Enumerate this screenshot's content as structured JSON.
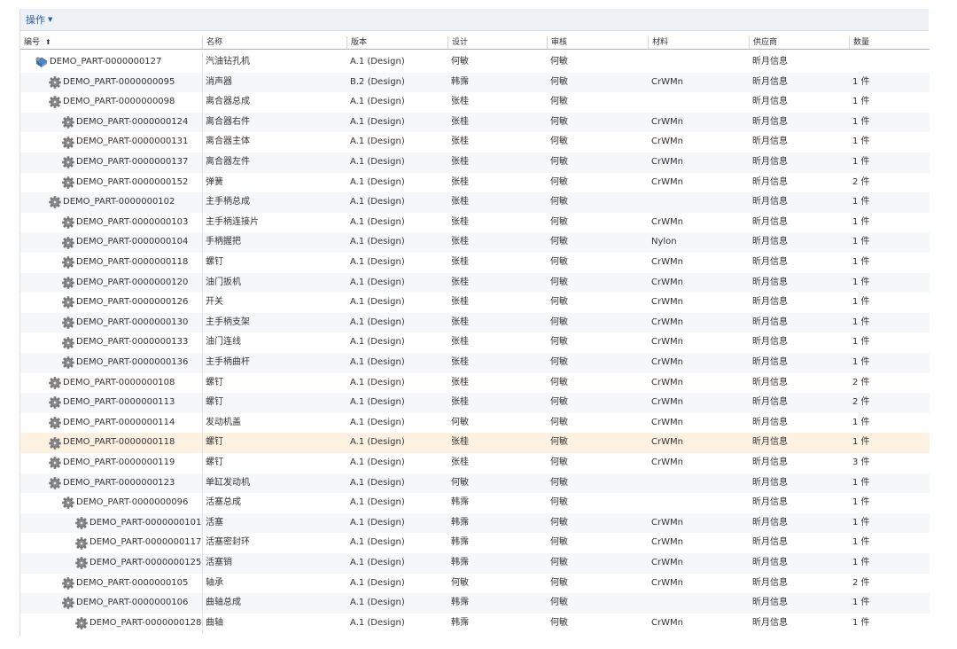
{
  "toolbar": {
    "action_label": "操作",
    "caret_icon": "caret-down-icon"
  },
  "columns": [
    {
      "key": "number",
      "label": "编号",
      "sort_icon": "sort-up-icon"
    },
    {
      "key": "name",
      "label": "名称"
    },
    {
      "key": "version",
      "label": "版本"
    },
    {
      "key": "design",
      "label": "设计"
    },
    {
      "key": "review",
      "label": "审核"
    },
    {
      "key": "material",
      "label": "材料"
    },
    {
      "key": "supplier",
      "label": "供应商"
    },
    {
      "key": "quantity",
      "label": "数量"
    }
  ],
  "icons": {
    "root": "assembly-icon",
    "part": "gear-part-icon"
  },
  "rows": [
    {
      "level": 0,
      "number": "DEMO_PART-0000000127",
      "name": "汽油钻孔机",
      "version": "A.1 (Design)",
      "design": "何敏",
      "review": "何敏",
      "material": "",
      "supplier": "昕月信息",
      "quantity": ""
    },
    {
      "level": 1,
      "number": "DEMO_PART-0000000095",
      "name": "消声器",
      "version": "B.2 (Design)",
      "design": "韩霈",
      "review": "何敏",
      "material": "CrWMn",
      "supplier": "昕月信息",
      "quantity": "1 件"
    },
    {
      "level": 1,
      "number": "DEMO_PART-0000000098",
      "name": "离合器总成",
      "version": "A.1 (Design)",
      "design": "张桂",
      "review": "何敏",
      "material": "",
      "supplier": "昕月信息",
      "quantity": "1 件"
    },
    {
      "level": 2,
      "number": "DEMO_PART-0000000124",
      "name": "离合器右件",
      "version": "A.1 (Design)",
      "design": "张桂",
      "review": "何敏",
      "material": "CrWMn",
      "supplier": "昕月信息",
      "quantity": "1 件"
    },
    {
      "level": 2,
      "number": "DEMO_PART-0000000131",
      "name": "离合器主体",
      "version": "A.1 (Design)",
      "design": "张桂",
      "review": "何敏",
      "material": "CrWMn",
      "supplier": "昕月信息",
      "quantity": "1 件"
    },
    {
      "level": 2,
      "number": "DEMO_PART-0000000137",
      "name": "离合器左件",
      "version": "A.1 (Design)",
      "design": "张桂",
      "review": "何敏",
      "material": "CrWMn",
      "supplier": "昕月信息",
      "quantity": "1 件"
    },
    {
      "level": 2,
      "number": "DEMO_PART-0000000152",
      "name": "弹簧",
      "version": "A.1 (Design)",
      "design": "张桂",
      "review": "何敏",
      "material": "CrWMn",
      "supplier": "昕月信息",
      "quantity": "2 件"
    },
    {
      "level": 1,
      "number": "DEMO_PART-0000000102",
      "name": "主手柄总成",
      "version": "A.1 (Design)",
      "design": "张桂",
      "review": "何敏",
      "material": "",
      "supplier": "昕月信息",
      "quantity": "1 件"
    },
    {
      "level": 2,
      "number": "DEMO_PART-0000000103",
      "name": "主手柄连接片",
      "version": "A.1 (Design)",
      "design": "张桂",
      "review": "何敏",
      "material": "CrWMn",
      "supplier": "昕月信息",
      "quantity": "1 件"
    },
    {
      "level": 2,
      "number": "DEMO_PART-0000000104",
      "name": "手柄握把",
      "version": "A.1 (Design)",
      "design": "张桂",
      "review": "何敏",
      "material": "Nylon",
      "supplier": "昕月信息",
      "quantity": "1 件"
    },
    {
      "level": 2,
      "number": "DEMO_PART-0000000118",
      "name": "螺钉",
      "version": "A.1 (Design)",
      "design": "张桂",
      "review": "何敏",
      "material": "CrWMn",
      "supplier": "昕月信息",
      "quantity": "1 件"
    },
    {
      "level": 2,
      "number": "DEMO_PART-0000000120",
      "name": "油门扳机",
      "version": "A.1 (Design)",
      "design": "张桂",
      "review": "何敏",
      "material": "CrWMn",
      "supplier": "昕月信息",
      "quantity": "1 件"
    },
    {
      "level": 2,
      "number": "DEMO_PART-0000000126",
      "name": "开关",
      "version": "A.1 (Design)",
      "design": "张桂",
      "review": "何敏",
      "material": "CrWMn",
      "supplier": "昕月信息",
      "quantity": "1 件"
    },
    {
      "level": 2,
      "number": "DEMO_PART-0000000130",
      "name": "主手柄支架",
      "version": "A.1 (Design)",
      "design": "张桂",
      "review": "何敏",
      "material": "CrWMn",
      "supplier": "昕月信息",
      "quantity": "1 件"
    },
    {
      "level": 2,
      "number": "DEMO_PART-0000000133",
      "name": "油门连线",
      "version": "A.1 (Design)",
      "design": "张桂",
      "review": "何敏",
      "material": "CrWMn",
      "supplier": "昕月信息",
      "quantity": "1 件"
    },
    {
      "level": 2,
      "number": "DEMO_PART-0000000136",
      "name": "主手柄曲杆",
      "version": "A.1 (Design)",
      "design": "张桂",
      "review": "何敏",
      "material": "CrWMn",
      "supplier": "昕月信息",
      "quantity": "1 件"
    },
    {
      "level": 1,
      "number": "DEMO_PART-0000000108",
      "name": "螺钉",
      "version": "A.1 (Design)",
      "design": "张桂",
      "review": "何敏",
      "material": "CrWMn",
      "supplier": "昕月信息",
      "quantity": "2 件"
    },
    {
      "level": 1,
      "number": "DEMO_PART-0000000113",
      "name": "螺钉",
      "version": "A.1 (Design)",
      "design": "张桂",
      "review": "何敏",
      "material": "CrWMn",
      "supplier": "昕月信息",
      "quantity": "2 件"
    },
    {
      "level": 1,
      "number": "DEMO_PART-0000000114",
      "name": "发动机盖",
      "version": "A.1 (Design)",
      "design": "何敏",
      "review": "何敏",
      "material": "CrWMn",
      "supplier": "昕月信息",
      "quantity": "1 件"
    },
    {
      "level": 1,
      "number": "DEMO_PART-0000000118",
      "name": "螺钉",
      "version": "A.1 (Design)",
      "design": "张桂",
      "review": "何敏",
      "material": "CrWMn",
      "supplier": "昕月信息",
      "quantity": "1 件",
      "selected": true
    },
    {
      "level": 1,
      "number": "DEMO_PART-0000000119",
      "name": "螺钉",
      "version": "A.1 (Design)",
      "design": "张桂",
      "review": "何敏",
      "material": "CrWMn",
      "supplier": "昕月信息",
      "quantity": "3 件"
    },
    {
      "level": 1,
      "number": "DEMO_PART-0000000123",
      "name": "单缸发动机",
      "version": "A.1 (Design)",
      "design": "何敏",
      "review": "何敏",
      "material": "",
      "supplier": "昕月信息",
      "quantity": "1 件"
    },
    {
      "level": 2,
      "number": "DEMO_PART-0000000096",
      "name": "活塞总成",
      "version": "A.1 (Design)",
      "design": "韩霈",
      "review": "何敏",
      "material": "",
      "supplier": "昕月信息",
      "quantity": "1 件"
    },
    {
      "level": 3,
      "number": "DEMO_PART-0000000101",
      "name": "活塞",
      "version": "A.1 (Design)",
      "design": "韩霈",
      "review": "何敏",
      "material": "CrWMn",
      "supplier": "昕月信息",
      "quantity": "1 件"
    },
    {
      "level": 3,
      "number": "DEMO_PART-0000000117",
      "name": "活塞密封环",
      "version": "A.1 (Design)",
      "design": "韩霈",
      "review": "何敏",
      "material": "CrWMn",
      "supplier": "昕月信息",
      "quantity": "1 件"
    },
    {
      "level": 3,
      "number": "DEMO_PART-0000000125",
      "name": "活塞销",
      "version": "A.1 (Design)",
      "design": "韩霈",
      "review": "何敏",
      "material": "CrWMn",
      "supplier": "昕月信息",
      "quantity": "1 件"
    },
    {
      "level": 2,
      "number": "DEMO_PART-0000000105",
      "name": "轴承",
      "version": "A.1 (Design)",
      "design": "何敏",
      "review": "何敏",
      "material": "CrWMn",
      "supplier": "昕月信息",
      "quantity": "2 件"
    },
    {
      "level": 2,
      "number": "DEMO_PART-0000000106",
      "name": "曲轴总成",
      "version": "A.1 (Design)",
      "design": "韩霈",
      "review": "何敏",
      "material": "",
      "supplier": "昕月信息",
      "quantity": "1 件"
    },
    {
      "level": 3,
      "number": "DEMO_PART-0000000128",
      "name": "曲轴",
      "version": "A.1 (Design)",
      "design": "韩霈",
      "review": "何敏",
      "material": "CrWMn",
      "supplier": "昕月信息",
      "quantity": "1 件"
    }
  ]
}
